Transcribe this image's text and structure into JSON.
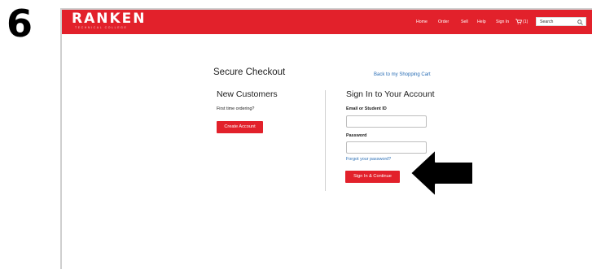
{
  "step_number": "6",
  "brand": {
    "name": "RANKEN",
    "tagline": "TECHNICAL COLLEGE"
  },
  "nav": {
    "home": "Home",
    "order": "Order",
    "sell": "Sell",
    "help": "Help",
    "sign_in": "Sign In",
    "cart_count": "(1)",
    "search_placeholder": "Search"
  },
  "page": {
    "title": "Secure Checkout",
    "back_link": "Back to my Shopping Cart"
  },
  "new_customers": {
    "heading": "New Customers",
    "prompt": "First time ordering?",
    "create_button": "Create Account"
  },
  "sign_in": {
    "heading": "Sign In to Your Account",
    "email_label": "Email or Student ID",
    "email_value": "",
    "password_label": "Password",
    "password_value": "",
    "forgot_link": "Forgot your password?",
    "continue_button": "Sign In & Continue"
  },
  "colors": {
    "brand_red": "#e2212b",
    "link_blue": "#2a6eb5"
  }
}
